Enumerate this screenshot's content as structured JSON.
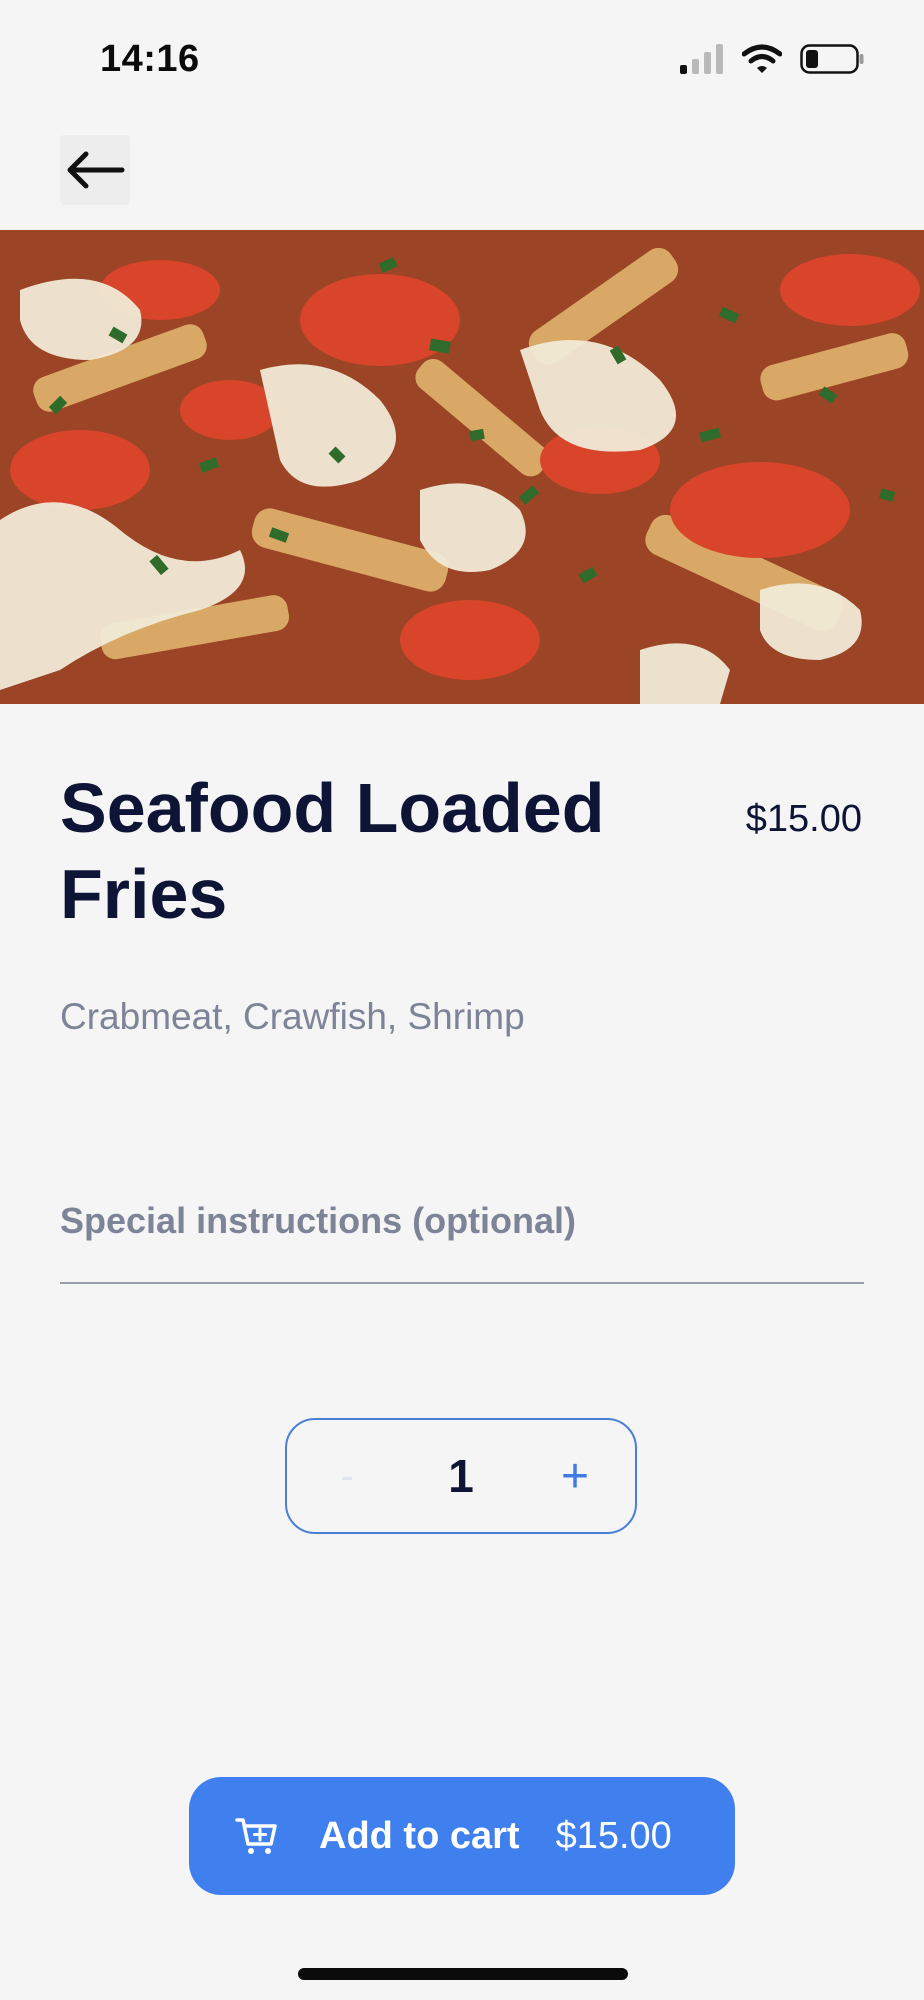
{
  "status_bar": {
    "time": "14:16",
    "icons": [
      "signal-icon",
      "wifi-icon",
      "battery-icon"
    ]
  },
  "nav": {
    "back_icon": "arrow-left-icon"
  },
  "item": {
    "name": "Seafood Loaded Fries",
    "price": "$15.00",
    "description": "Crabmeat, Crawfish, Shrimp",
    "image": "seafood-loaded-fries-photo"
  },
  "instructions": {
    "label": "Special instructions (optional)"
  },
  "quantity": {
    "minus": "-",
    "value": "1",
    "plus": "+"
  },
  "cart_button": {
    "icon": "cart-plus-icon",
    "label": "Add to cart",
    "price": "$15.00"
  },
  "colors": {
    "background": "#f5f5f5",
    "accent": "#3f80ee",
    "title_text": "#0e1435",
    "muted_text": "#7e8497"
  }
}
